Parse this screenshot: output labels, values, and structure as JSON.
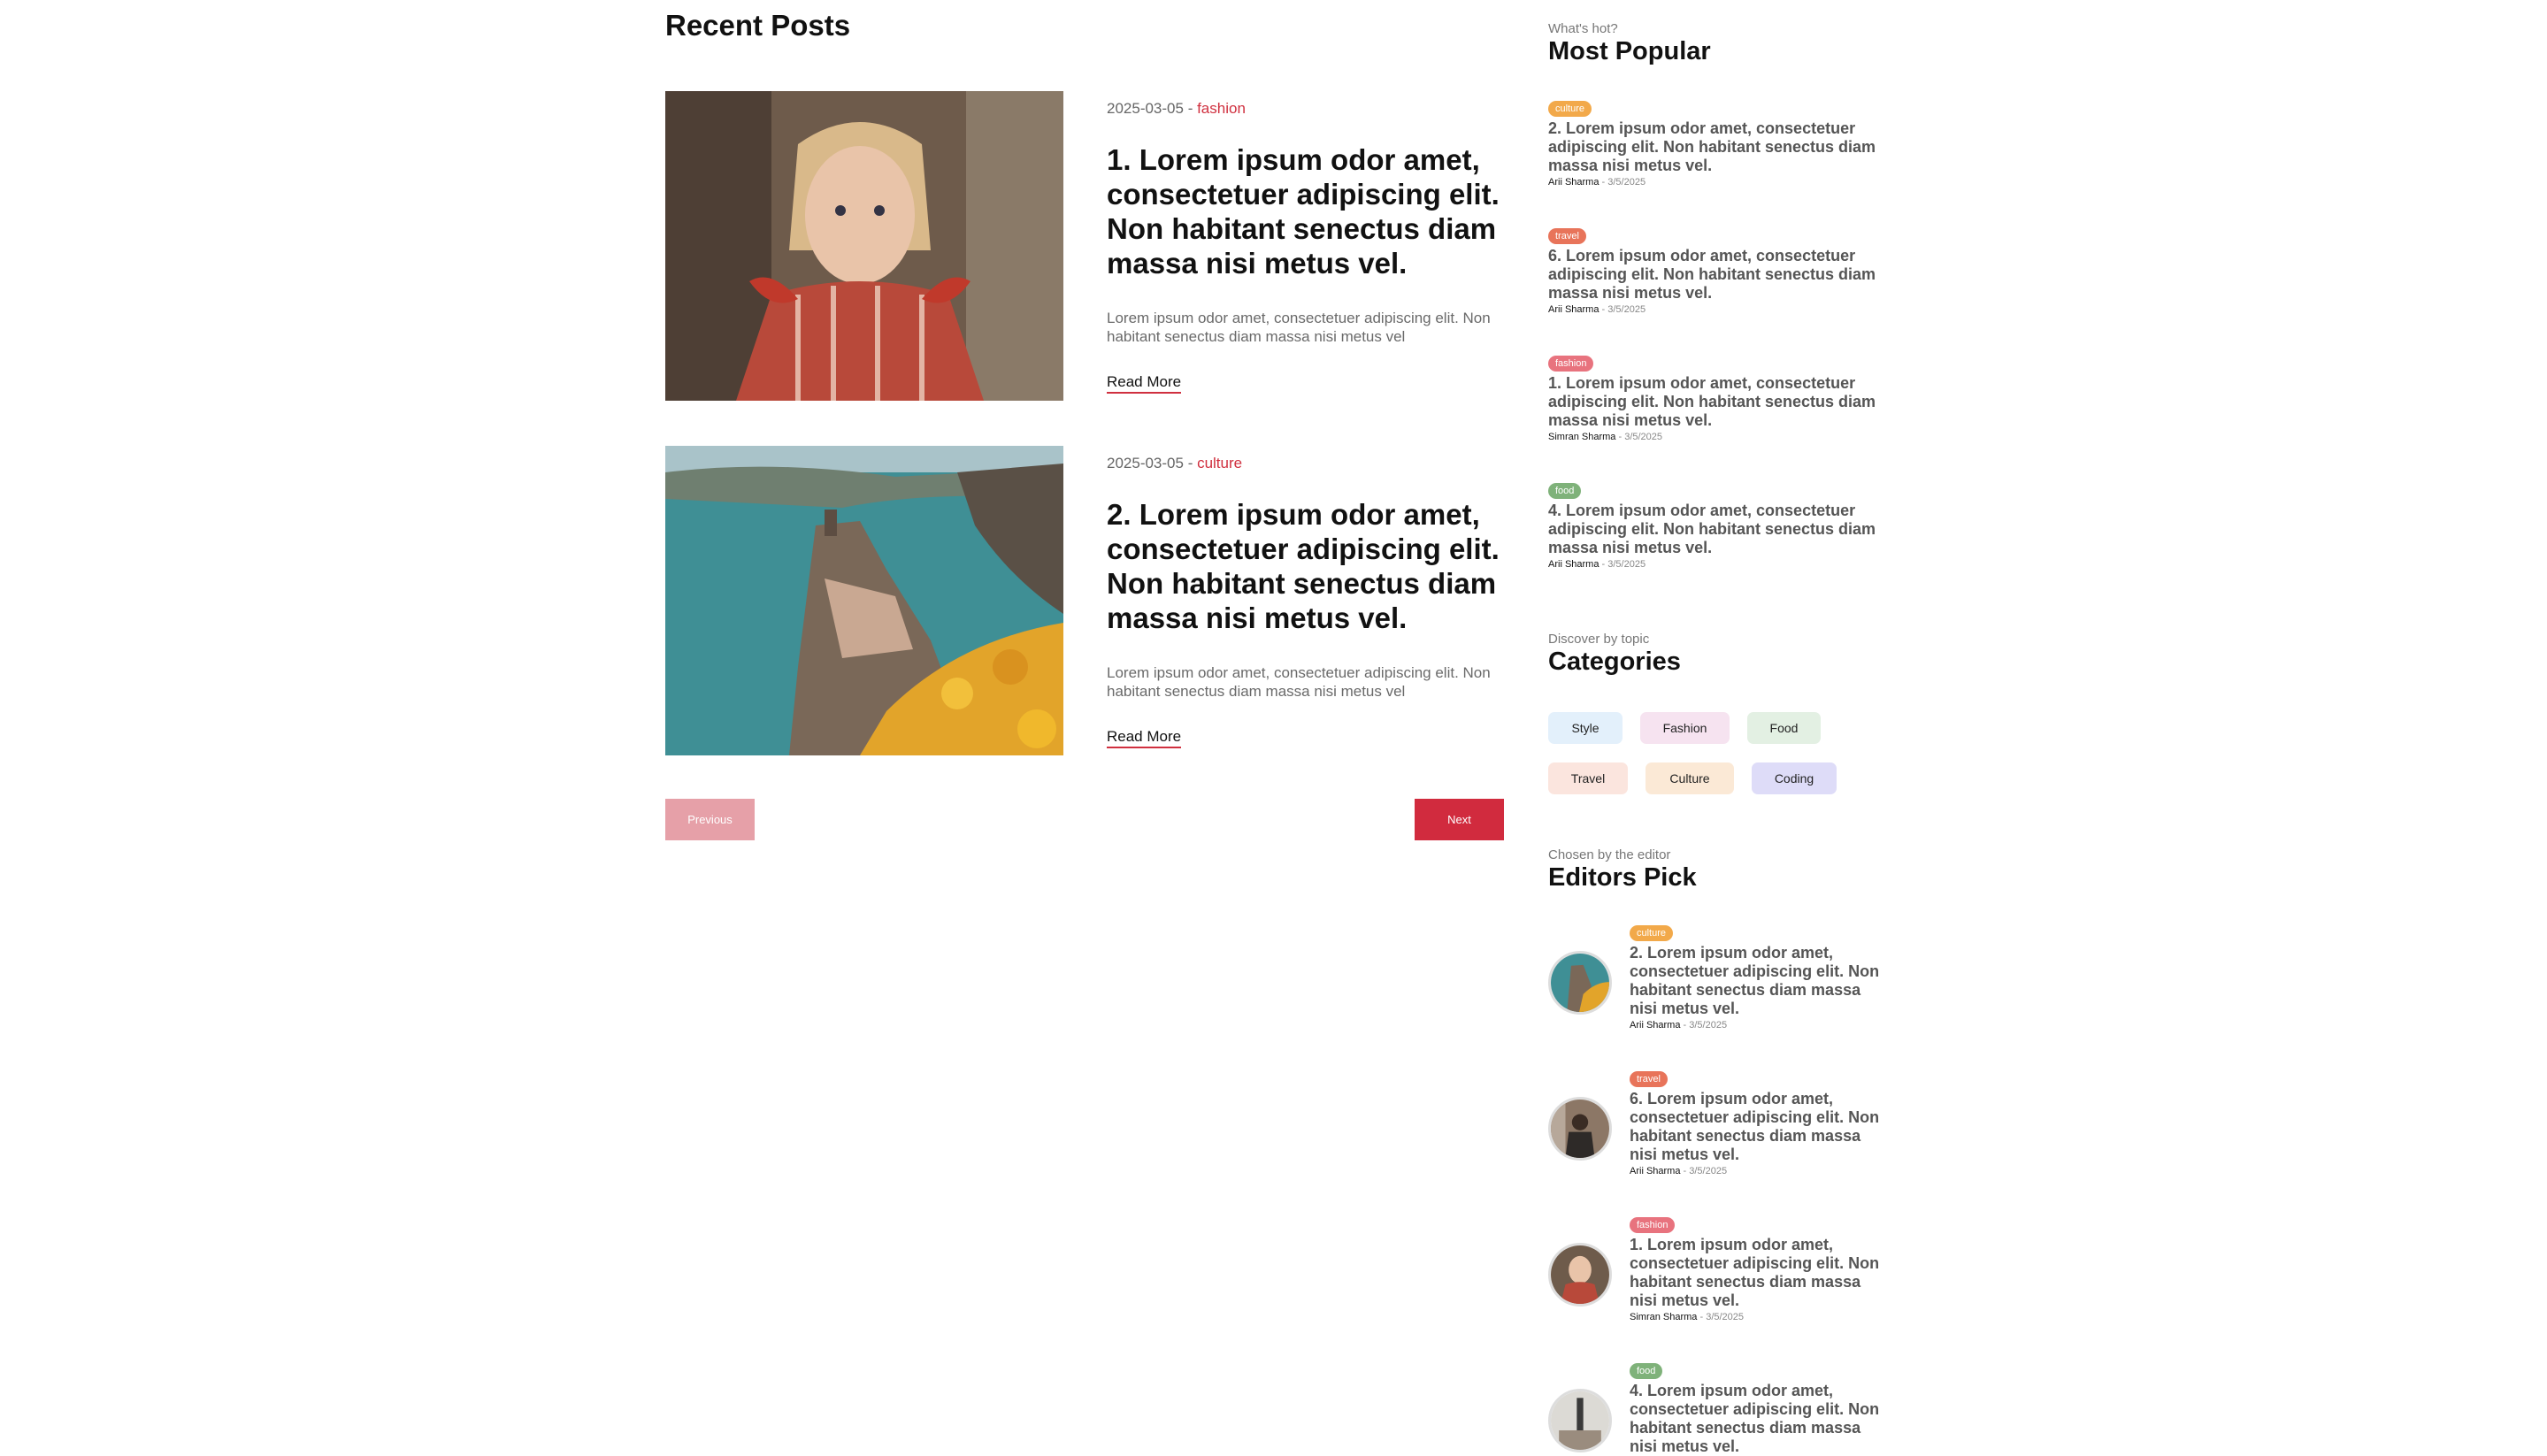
{
  "main": {
    "title": "Recent Posts",
    "posts": [
      {
        "date": "2025-03-05",
        "sep": " - ",
        "category": "fashion",
        "title": "1. Lorem ipsum odor amet, consectetuer adipiscing elit. Non habitant senectus diam massa nisi metus vel.",
        "excerpt": "Lorem ipsum odor amet, consectetuer adipiscing elit. Non habitant senectus diam massa nisi metus vel",
        "read_more": "Read More"
      },
      {
        "date": "2025-03-05",
        "sep": " - ",
        "category": "culture",
        "title": "2. Lorem ipsum odor amet, consectetuer adipiscing elit. Non habitant senectus diam massa nisi metus vel.",
        "excerpt": "Lorem ipsum odor amet, consectetuer adipiscing elit. Non habitant senectus diam massa nisi metus vel",
        "read_more": "Read More"
      }
    ],
    "pagination": {
      "previous": "Previous",
      "next": "Next"
    }
  },
  "sidebar": {
    "popular": {
      "subtitle": "What's hot?",
      "title": "Most Popular",
      "items": [
        {
          "tag": "culture",
          "tag_color": "#f2a94a",
          "title": "2. Lorem ipsum odor amet, consectetuer adipiscing elit. Non habitant senectus diam massa nisi metus vel.",
          "author": "Arii Sharma",
          "date": " - 3/5/2025"
        },
        {
          "tag": "travel",
          "tag_color": "#e8745a",
          "title": "6. Lorem ipsum odor amet, consectetuer adipiscing elit. Non habitant senectus diam massa nisi metus vel.",
          "author": "Arii Sharma",
          "date": " - 3/5/2025"
        },
        {
          "tag": "fashion",
          "tag_color": "#e8737e",
          "title": "1. Lorem ipsum odor amet, consectetuer adipiscing elit. Non habitant senectus diam massa nisi metus vel.",
          "author": "Simran Sharma",
          "date": " - 3/5/2025"
        },
        {
          "tag": "food",
          "tag_color": "#7fb27a",
          "title": "4. Lorem ipsum odor amet, consectetuer adipiscing elit. Non habitant senectus diam massa nisi metus vel.",
          "author": "Arii Sharma",
          "date": " - 3/5/2025"
        }
      ]
    },
    "categories": {
      "subtitle": "Discover by topic",
      "title": "Categories",
      "items": [
        {
          "label": "Style",
          "color": "#e3f0fb"
        },
        {
          "label": "Fashion",
          "color": "#f6e3f0"
        },
        {
          "label": "Food",
          "color": "#e3f0e3"
        },
        {
          "label": "Travel",
          "color": "#fbe5de"
        },
        {
          "label": "Culture",
          "color": "#fbe9d6"
        },
        {
          "label": "Coding",
          "color": "#dedcf8"
        }
      ]
    },
    "editors_pick": {
      "subtitle": "Chosen by the editor",
      "title": "Editors Pick",
      "items": [
        {
          "tag": "culture",
          "tag_color": "#f2a94a",
          "title": "2. Lorem ipsum odor amet, consectetuer adipiscing elit. Non habitant senectus diam massa nisi metus vel.",
          "author": "Arii Sharma",
          "date": " - 3/5/2025"
        },
        {
          "tag": "travel",
          "tag_color": "#e8745a",
          "title": "6. Lorem ipsum odor amet, consectetuer adipiscing elit. Non habitant senectus diam massa nisi metus vel.",
          "author": "Arii Sharma",
          "date": " - 3/5/2025"
        },
        {
          "tag": "fashion",
          "tag_color": "#e8737e",
          "title": "1. Lorem ipsum odor amet, consectetuer adipiscing elit. Non habitant senectus diam massa nisi metus vel.",
          "author": "Simran Sharma",
          "date": " - 3/5/2025"
        },
        {
          "tag": "food",
          "tag_color": "#7fb27a",
          "title": "4. Lorem ipsum odor amet, consectetuer adipiscing elit. Non habitant senectus diam massa nisi metus vel.",
          "author": "",
          "date": ""
        }
      ]
    }
  }
}
